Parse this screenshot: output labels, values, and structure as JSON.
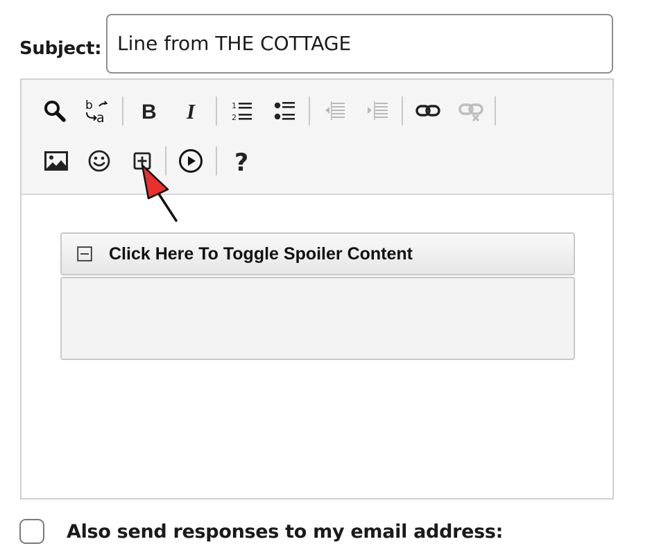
{
  "subject": {
    "label": "Subject:",
    "value": "Line from THE COTTAGE"
  },
  "toolbar": {
    "row1": [
      {
        "name": "find",
        "icon": "search-icon",
        "enabled": true
      },
      {
        "name": "replace",
        "icon": "find-replace-icon",
        "enabled": true
      },
      {
        "name": "bold",
        "icon": "bold-icon",
        "enabled": true
      },
      {
        "name": "italic",
        "icon": "italic-icon",
        "enabled": true
      },
      {
        "name": "numbered-list",
        "icon": "numbered-list-icon",
        "enabled": true
      },
      {
        "name": "bulleted-list",
        "icon": "bulleted-list-icon",
        "enabled": true
      },
      {
        "name": "decrease-indent",
        "icon": "outdent-icon",
        "enabled": false
      },
      {
        "name": "increase-indent",
        "icon": "indent-icon",
        "enabled": false
      },
      {
        "name": "link",
        "icon": "link-icon",
        "enabled": true
      },
      {
        "name": "unlink",
        "icon": "unlink-icon",
        "enabled": false
      }
    ],
    "row2": [
      {
        "name": "image",
        "icon": "image-icon",
        "enabled": true
      },
      {
        "name": "smiley",
        "icon": "smiley-icon",
        "enabled": true
      },
      {
        "name": "spoiler",
        "icon": "plus-box-icon",
        "enabled": true
      },
      {
        "name": "video",
        "icon": "play-circle-icon",
        "enabled": true
      },
      {
        "name": "help",
        "icon": "help-icon",
        "enabled": true
      }
    ]
  },
  "spoiler": {
    "title": "Click Here To Toggle Spoiler Content",
    "toggle_icon": "minus-box-icon",
    "body": ""
  },
  "email_option": {
    "label": "Also send responses to my email address:",
    "checked": false
  },
  "annotation": {
    "arrow_color": "#e8312f"
  }
}
